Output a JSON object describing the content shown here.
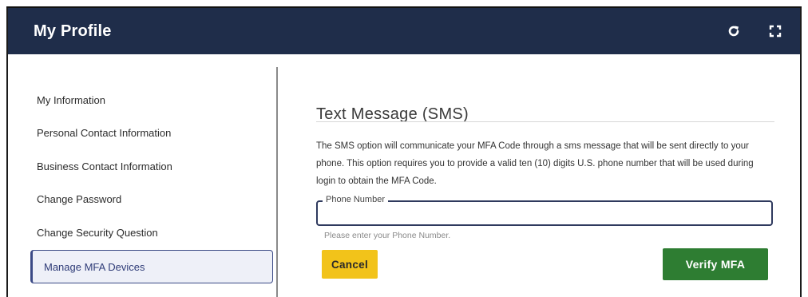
{
  "header": {
    "title": "My Profile",
    "icons": [
      "refresh-icon",
      "fullscreen-icon"
    ]
  },
  "sidebar": {
    "items": [
      {
        "label": "My Information"
      },
      {
        "label": "Personal Contact Information"
      },
      {
        "label": "Business Contact Information"
      },
      {
        "label": "Change Password"
      },
      {
        "label": "Change Security Question"
      },
      {
        "label": "Manage MFA Devices",
        "active": true
      }
    ]
  },
  "main": {
    "section_title": "Text Message (SMS)",
    "description": "The SMS option will communicate your MFA Code through a sms message that will be sent directly to your phone. This option requires you to provide a valid ten (10) digits U.S. phone number that will be used during login to obtain the MFA Code.",
    "phone_field": {
      "label": "Phone Number",
      "value": "",
      "helper": "Please enter your Phone Number."
    },
    "cancel_label": "Cancel",
    "verify_label": "Verify MFA"
  },
  "colors": {
    "header_bg": "#1f2d4a",
    "active_nav_border": "#3b4a86",
    "cancel_bg": "#f2c31a",
    "verify_bg": "#2e7d32"
  }
}
